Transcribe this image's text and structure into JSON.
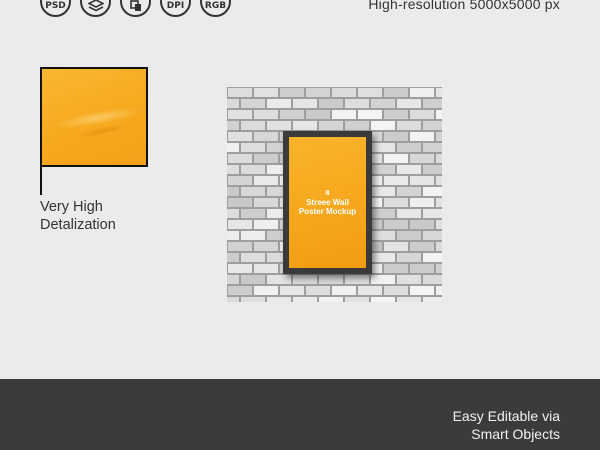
{
  "header": {
    "badges": [
      {
        "label": "PSD",
        "icon": "psd-badge-icon"
      },
      {
        "label": "",
        "icon": "layers-icon"
      },
      {
        "label": "",
        "icon": "smart-object-icon"
      },
      {
        "label": "DPI",
        "icon": "dpi-badge-icon"
      },
      {
        "label": "RGB",
        "icon": "rgb-badge-icon"
      }
    ],
    "resolution_text": "High-resolution 5000x5000 px"
  },
  "detail": {
    "line1": "Very High",
    "line2": "Detalization"
  },
  "mockup": {
    "poster_logo": "8",
    "poster_title": "Streee Wall Poster Mockup",
    "accent_color": "#f6a61b",
    "frame_color": "#3a3a3a",
    "wall_color": "#9e9e9e"
  },
  "footer": {
    "line1": "Easy Editable via",
    "line2": "Smart Objects",
    "background": "#3b3b3b"
  }
}
